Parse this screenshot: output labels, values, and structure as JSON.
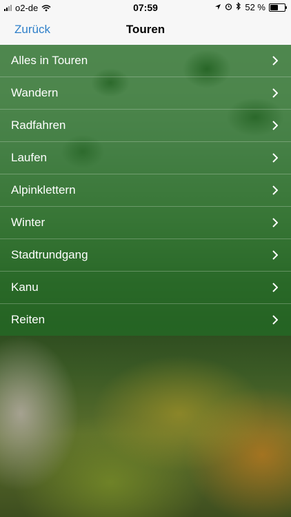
{
  "status_bar": {
    "carrier": "o2-de",
    "time": "07:59",
    "battery_percent": "52 %",
    "battery_level": 0.52
  },
  "navigation": {
    "back_label": "Zurück",
    "title": "Touren"
  },
  "list": {
    "items": [
      {
        "label": "Alles in Touren"
      },
      {
        "label": "Wandern"
      },
      {
        "label": "Radfahren"
      },
      {
        "label": "Laufen"
      },
      {
        "label": "Alpinklettern"
      },
      {
        "label": "Winter"
      },
      {
        "label": "Stadtrundgang"
      },
      {
        "label": "Kanu"
      },
      {
        "label": "Reiten"
      }
    ]
  },
  "colors": {
    "accent": "#2e7fc9",
    "row_background": "#226e26"
  }
}
